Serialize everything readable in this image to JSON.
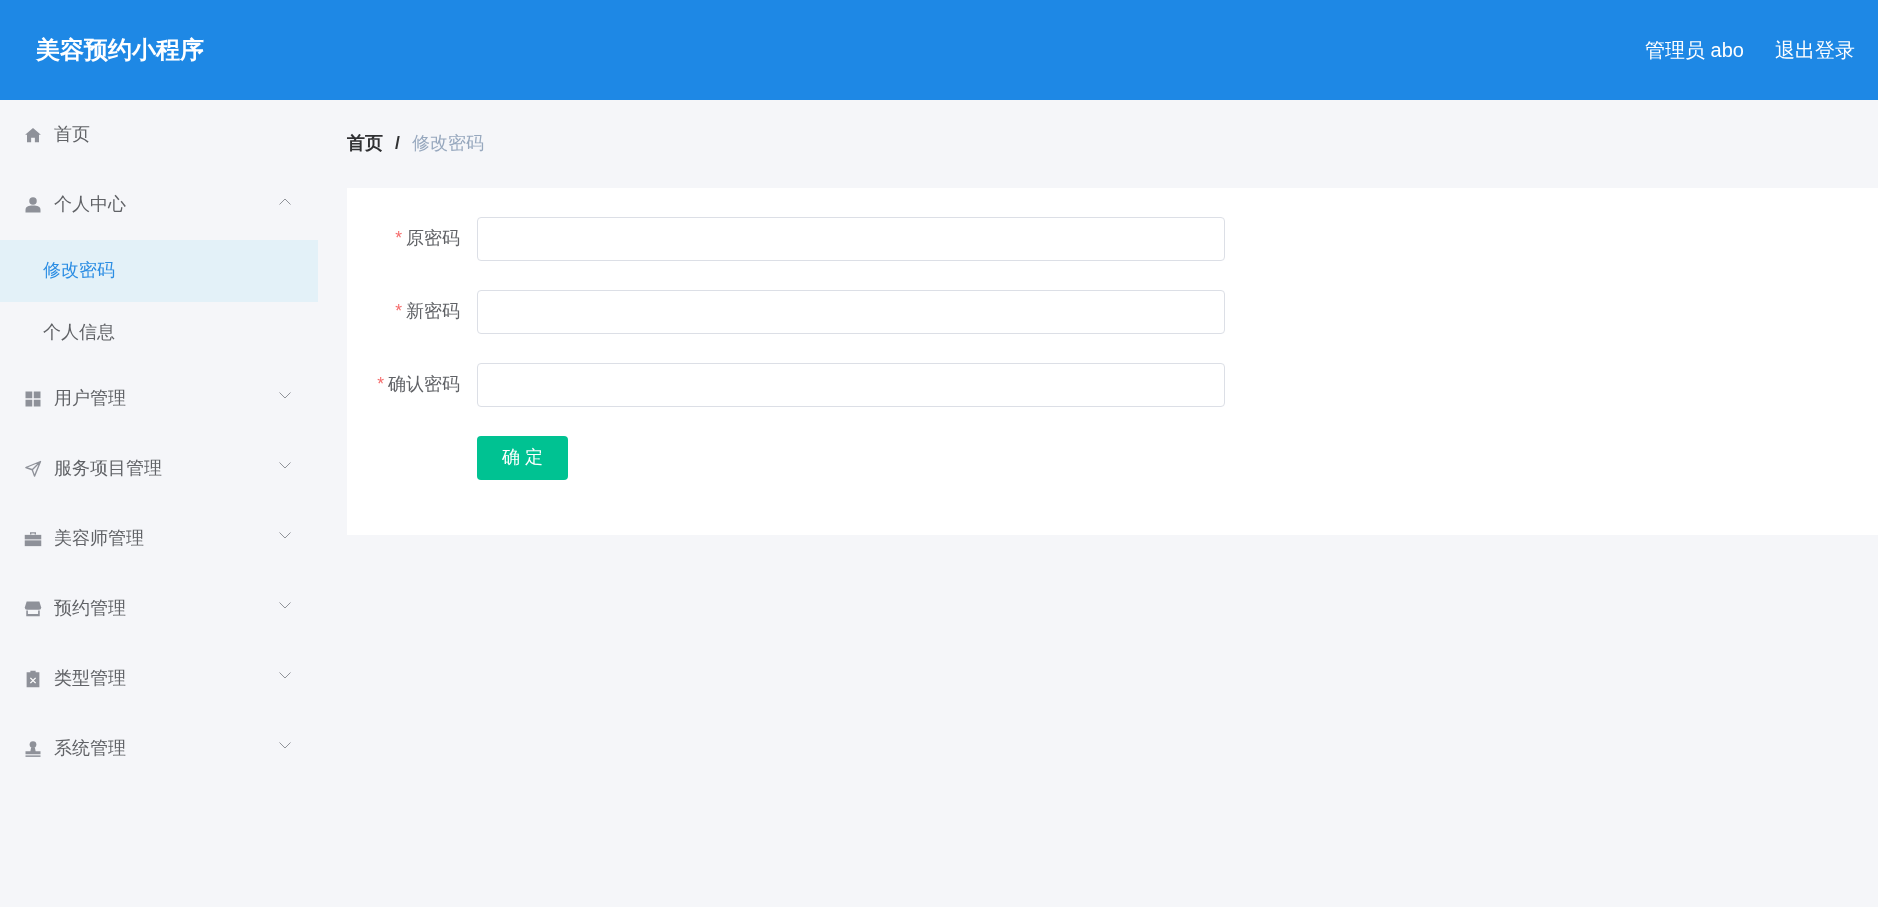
{
  "header": {
    "title": "美容预约小程序",
    "user": "管理员 abo",
    "logout": "退出登录"
  },
  "sidebar": {
    "items": [
      {
        "label": "首页",
        "kind": "item",
        "selected": false
      },
      {
        "label": "个人中心",
        "kind": "submenu",
        "selected": false,
        "expanded": true,
        "children": [
          {
            "label": "修改密码",
            "selected": true
          },
          {
            "label": "个人信息",
            "selected": false
          }
        ]
      },
      {
        "label": "用户管理",
        "kind": "submenu",
        "selected": false,
        "expanded": false
      },
      {
        "label": "服务项目管理",
        "kind": "submenu",
        "selected": false,
        "expanded": false
      },
      {
        "label": "美容师管理",
        "kind": "submenu",
        "selected": false,
        "expanded": false
      },
      {
        "label": "预约管理",
        "kind": "submenu",
        "selected": false,
        "expanded": false
      },
      {
        "label": "类型管理",
        "kind": "submenu",
        "selected": false,
        "expanded": false
      },
      {
        "label": "系统管理",
        "kind": "submenu",
        "selected": false,
        "expanded": false
      }
    ]
  },
  "breadcrumb": {
    "separator": "/",
    "items": [
      {
        "label": "首页",
        "current": false
      },
      {
        "label": "修改密码",
        "current": true
      }
    ]
  },
  "form": {
    "required_mark": "*",
    "fields": [
      {
        "label": "原密码",
        "required": true
      },
      {
        "label": "新密码",
        "required": true
      },
      {
        "label": "确认密码",
        "required": true
      }
    ],
    "submit": "确定"
  }
}
